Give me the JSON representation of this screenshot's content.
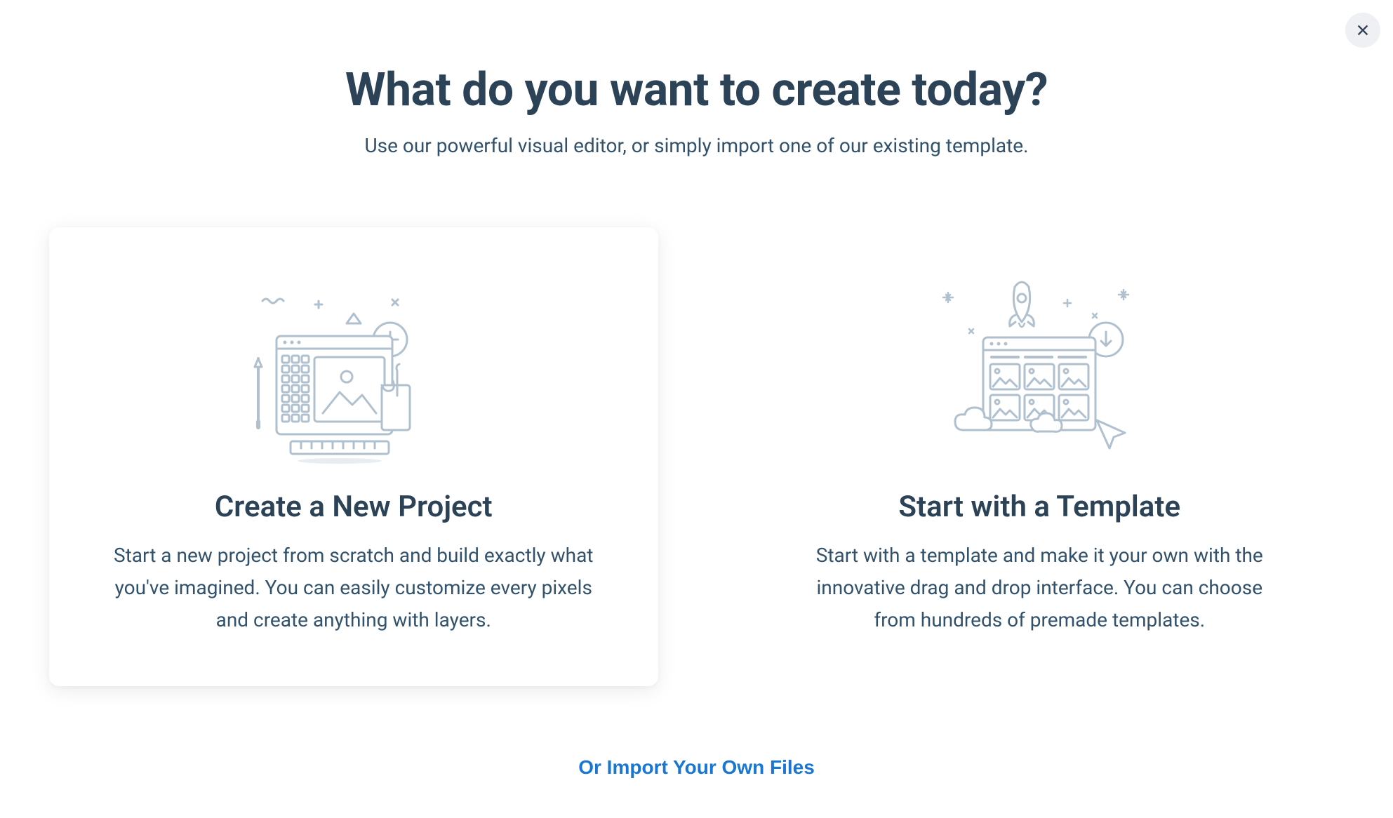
{
  "header": {
    "title": "What do you want to create today?",
    "subtitle": "Use our powerful visual editor, or simply import one of our existing template."
  },
  "options": [
    {
      "title": "Create a New Project",
      "description": "Start a new project from scratch and build exactly what you've imagined. You can easily customize every pixels and create anything with layers.",
      "selected": true
    },
    {
      "title": "Start with a Template",
      "description": "Start with a template and make it your own with the innovative drag and drop interface. You can choose from hundreds of premade templates.",
      "selected": false
    }
  ],
  "footer": {
    "import_link": "Or Import Your Own Files"
  },
  "colors": {
    "text_dark": "#2c4257",
    "text_body": "#32526b",
    "link_blue": "#1976d2",
    "illustration_stroke": "#b0c0cf",
    "close_bg": "#eef0f3"
  }
}
